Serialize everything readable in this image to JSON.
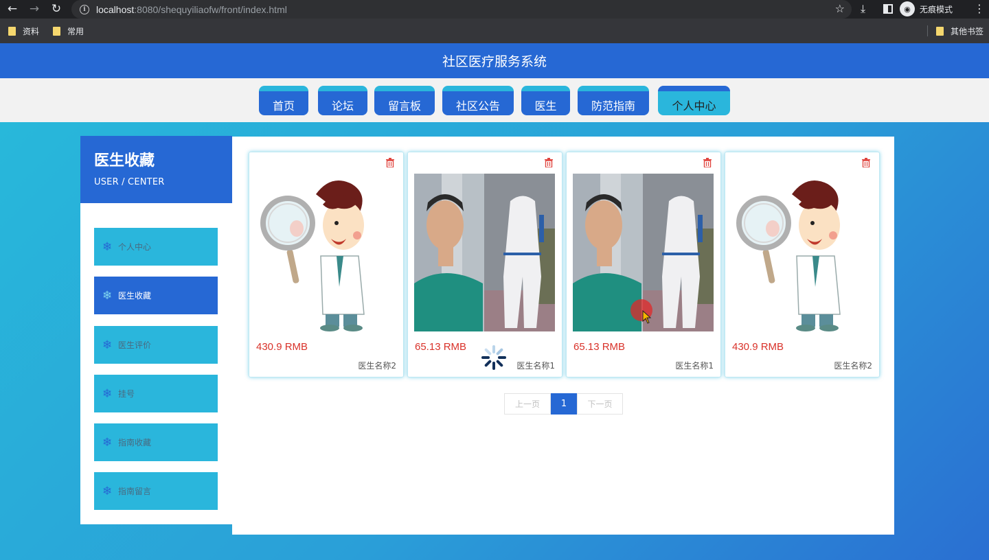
{
  "browser": {
    "url_host": "localhost",
    "url_rest": ":8080/shequyiliaofw/front/index.html",
    "incognito_label": "无痕模式",
    "bookmarks": [
      "资料",
      "常用"
    ],
    "other_bookmarks": "其他书签"
  },
  "app": {
    "title": "社区医疗服务系统"
  },
  "nav": {
    "items": [
      "首页",
      "论坛",
      "留言板",
      "社区公告",
      "医生",
      "防范指南",
      "个人中心"
    ],
    "active": "个人中心"
  },
  "sidebar": {
    "title": "医生收藏",
    "subtitle": "USER / CENTER",
    "items": [
      "个人中心",
      "医生收藏",
      "医生评价",
      "挂号",
      "指南收藏",
      "指南留言"
    ],
    "active": "医生收藏"
  },
  "cards": [
    {
      "price": "430.9 RMB",
      "name": "医生名称2",
      "image": "cartoon-doctor-magnifier"
    },
    {
      "price": "65.13 RMB",
      "name": "医生名称1",
      "image": "doctor-photo"
    },
    {
      "price": "65.13 RMB",
      "name": "医生名称1",
      "image": "doctor-photo"
    },
    {
      "price": "430.9 RMB",
      "name": "医生名称2",
      "image": "cartoon-doctor-magnifier"
    }
  ],
  "pager": {
    "prev": "上一页",
    "current": "1",
    "next": "下一页"
  },
  "colors": {
    "primary": "#2668d4",
    "accent": "#2ab6dc",
    "price": "#d9322a"
  }
}
